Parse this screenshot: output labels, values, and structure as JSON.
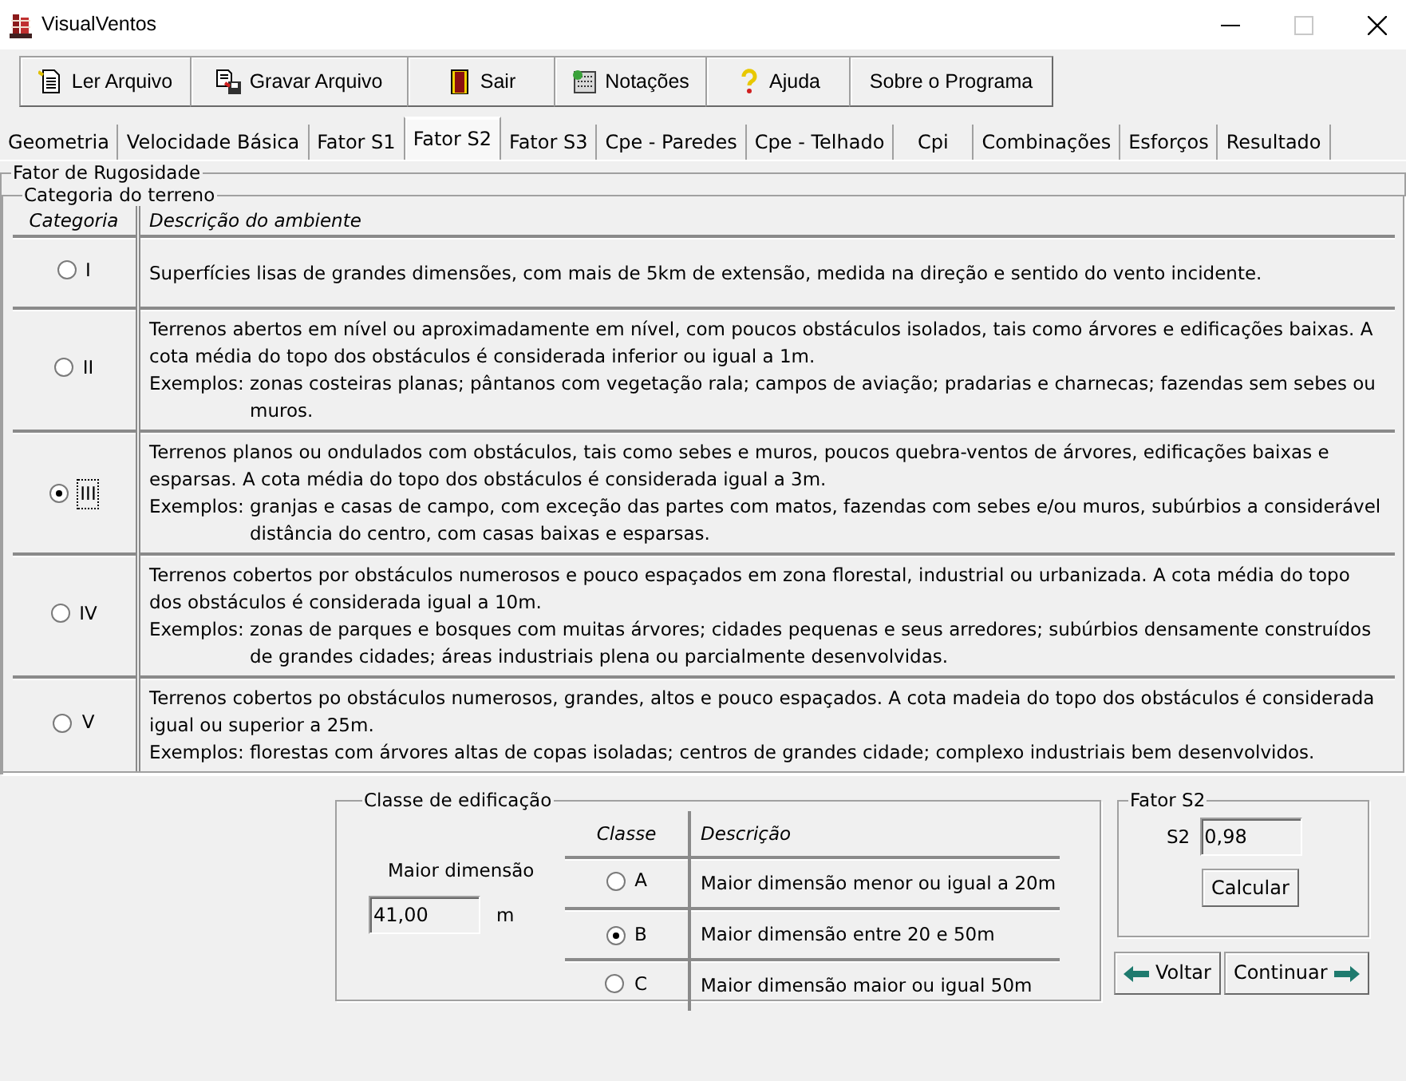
{
  "window": {
    "title": "VisualVentos"
  },
  "toolbar": [
    "Ler Arquivo",
    "Gravar Arquivo",
    "Sair",
    "Notações",
    "Ajuda",
    "Sobre o Programa"
  ],
  "tabs": [
    {
      "label": "Geometria",
      "selected": false
    },
    {
      "label": "Velocidade Básica",
      "selected": false
    },
    {
      "label": "Fator S1",
      "selected": false
    },
    {
      "label": "Fator S2",
      "selected": true
    },
    {
      "label": "Fator S3",
      "selected": false
    },
    {
      "label": "Cpe - Paredes",
      "selected": false
    },
    {
      "label": "Cpe - Telhado",
      "selected": false
    },
    {
      "label": "Cpi",
      "selected": false
    },
    {
      "label": "Combinações",
      "selected": false
    },
    {
      "label": "Esforços",
      "selected": false
    },
    {
      "label": "Resultado",
      "selected": false
    }
  ],
  "roughness": {
    "title": "Fator de Rugosidade",
    "terrain": {
      "title": "Categoria do terreno",
      "columns": [
        "Categoria",
        "Descrição do ambiente"
      ],
      "rows": [
        {
          "category": "I",
          "selected": false,
          "description": "Superfícies lisas de grandes dimensões, com mais de 5km de extensão, medida na direção e sentido do vento incidente."
        },
        {
          "category": "II",
          "selected": false,
          "description": "Terrenos abertos em nível ou aproximadamente em nível, com poucos obstáculos isolados, tais como árvores e edificações baixas. A cota média do topo dos obstáculos é considerada inferior ou igual a 1m.",
          "examples_label": "Exemplos:",
          "examples": "zonas costeiras planas; pântanos com vegetação rala; campos de aviação; pradarias e charnecas; fazendas sem sebes ou muros."
        },
        {
          "category": "III",
          "selected": true,
          "description": "Terrenos planos ou ondulados com obstáculos, tais como sebes e muros, poucos quebra-ventos de árvores, edificações baixas e esparsas. A cota média do topo dos obstáculos é considerada igual a 3m.",
          "examples_label": "Exemplos:",
          "examples": "granjas e casas de campo, com exceção das partes com matos, fazendas com sebes e/ou muros, subúrbios a considerável distância do centro, com casas baixas e esparsas."
        },
        {
          "category": "IV",
          "selected": false,
          "description": "Terrenos cobertos por obstáculos numerosos e pouco espaçados em zona florestal, industrial ou urbanizada. A cota média do topo dos obstáculos é considerada igual a 10m.",
          "examples_label": "Exemplos:",
          "examples": "zonas de parques e bosques com muitas árvores; cidades pequenas e seus arredores; subúrbios densamente construídos de grandes cidades; áreas industriais plena ou parcialmente desenvolvidas."
        },
        {
          "category": "V",
          "selected": false,
          "description": "Terrenos cobertos po obstáculos numerosos, grandes, altos e pouco espaçados. A cota madeia do topo dos obstáculos é considerada igual ou superior a 25m.",
          "examples_label": "Exemplos:",
          "examples": "florestas com árvores altas de copas isoladas; centros de grandes cidade; complexo industriais bem desenvolvidos."
        }
      ]
    }
  },
  "building_class": {
    "title": "Classe de edificação",
    "dimension_label": "Maior dimensão",
    "dimension_value": "41,00",
    "unit": "m",
    "columns": [
      "Classe",
      "Descrição"
    ],
    "rows": [
      {
        "class": "A",
        "selected": false,
        "description": "Maior dimensão menor ou igual a 20m"
      },
      {
        "class": "B",
        "selected": true,
        "description": "Maior dimensão entre 20 e 50m"
      },
      {
        "class": "C",
        "selected": false,
        "description": "Maior dimensão maior ou igual 50m"
      }
    ]
  },
  "factor": {
    "title": "Fator S2",
    "label": "S2",
    "value": "0,98",
    "button": "Calcular"
  },
  "nav_buttons": [
    "Voltar",
    "Continuar"
  ]
}
